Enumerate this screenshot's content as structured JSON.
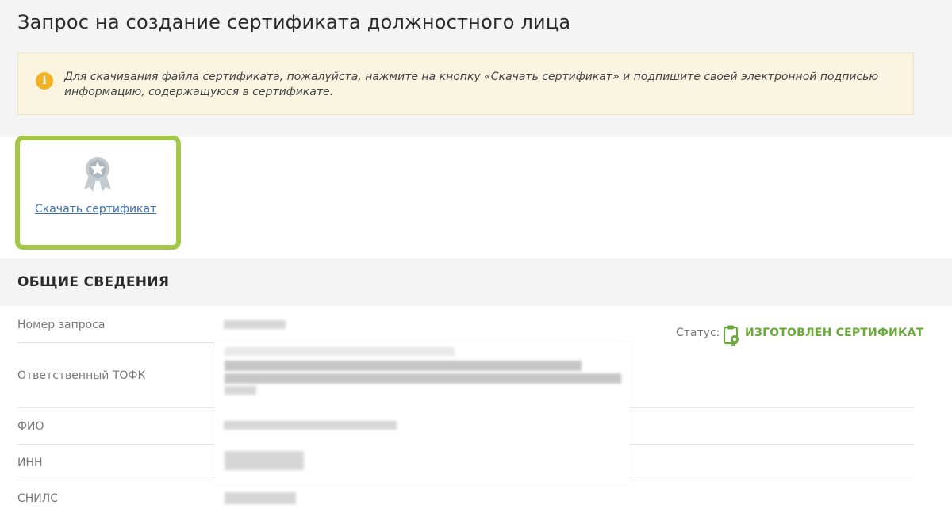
{
  "page": {
    "title": "Запрос на создание сертификата должностного лица"
  },
  "info_box": {
    "icon": "info-icon",
    "icon_glyph": "i",
    "text": "Для скачивания файла сертификата, пожалуйста, нажмите на кнопку «Скачать сертификат» и подпишите своей электронной подписью информацию, содержащуюся в сертификате."
  },
  "certificate_card": {
    "icon": "certificate-badge-icon",
    "link_label": "Скачать сертификат",
    "highlight_color": "#a3c846"
  },
  "general_info": {
    "section_title": "ОБЩИЕ СВЕДЕНИЯ",
    "fields": [
      {
        "label": "Номер запроса"
      },
      {
        "label": "Ответственный ТОФК"
      },
      {
        "label": "ФИО"
      },
      {
        "label": "ИНН"
      },
      {
        "label": "СНИЛС"
      }
    ],
    "status": {
      "label": "Статус:",
      "icon": "certificate-clipboard-icon",
      "value": "ИЗГОТОВЛЕН СЕРТИФИКАТ",
      "color": "#6aaa3a"
    }
  },
  "colors": {
    "link": "#3b6fb6",
    "info_background": "#f8f4e0",
    "info_icon": "#f2b224"
  }
}
